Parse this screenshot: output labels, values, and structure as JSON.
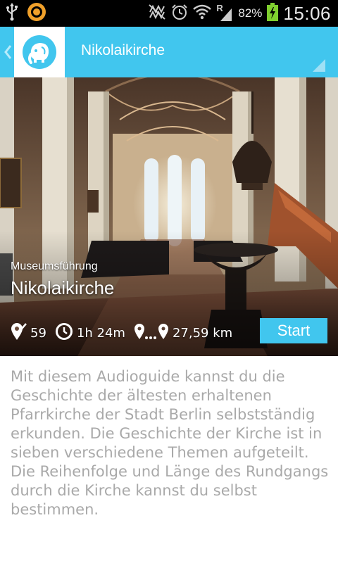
{
  "status_bar": {
    "battery_percent": "82%",
    "time": "15:06",
    "signal_roaming_label": "R",
    "icons": [
      "usb-icon",
      "app-notification-icon",
      "mute-icon",
      "alarm-icon",
      "wifi-icon",
      "signal-icon",
      "battery-charging-icon"
    ]
  },
  "app_bar": {
    "title": "Nikolaikirche",
    "logo": "elephant-logo",
    "accent_color": "#41c6ee"
  },
  "hero": {
    "subtitle": "Museumsführung",
    "title": "Nikolaikirche",
    "stats": {
      "stops": "59",
      "duration": "1h 24m",
      "distance": "27,59 km"
    },
    "start_label": "Start"
  },
  "description": "Mit diesem Audioguide kannst du die Geschichte der ältesten erhaltenen Pfarrkirche der Stadt Berlin selbstständig erkunden. Die Geschichte der Kirche ist in sieben verschiedene Themen aufgeteilt. Die Reihenfolge und Länge des Rundgangs durch die Kirche kannst du selbst bestimmen."
}
